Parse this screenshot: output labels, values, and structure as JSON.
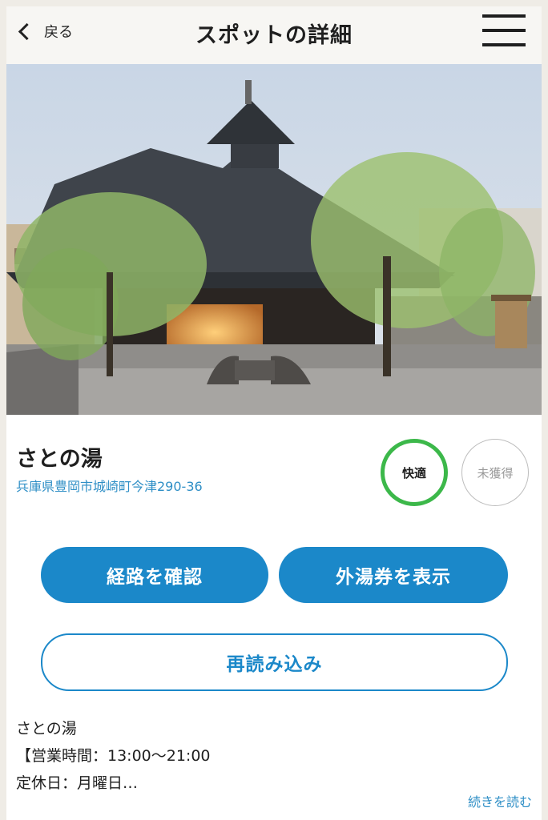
{
  "header": {
    "back_label": "戻る",
    "title": "スポットの詳細"
  },
  "spot": {
    "name": "さとの湯",
    "address": "兵庫県豊岡市城崎町今津290-36",
    "badges": {
      "comfort": "快適",
      "unacquired": "未獲得"
    }
  },
  "actions": {
    "route_label": "経路を確認",
    "ticket_label": "外湯券を表示",
    "reload_label": "再読み込み"
  },
  "description": {
    "lines": [
      "さとの湯",
      "【営業時間：13:00〜21:00",
      "定休日：月曜日…"
    ],
    "read_more": "続きを読む"
  },
  "colors": {
    "accent": "#1b88c9",
    "link": "#2f8fc6",
    "comfort_ring": "#3cb84a",
    "unacquired_ring": "#bdbdbd"
  },
  "icons": {
    "back": "chevron-left-icon",
    "menu": "hamburger-menu-icon"
  }
}
